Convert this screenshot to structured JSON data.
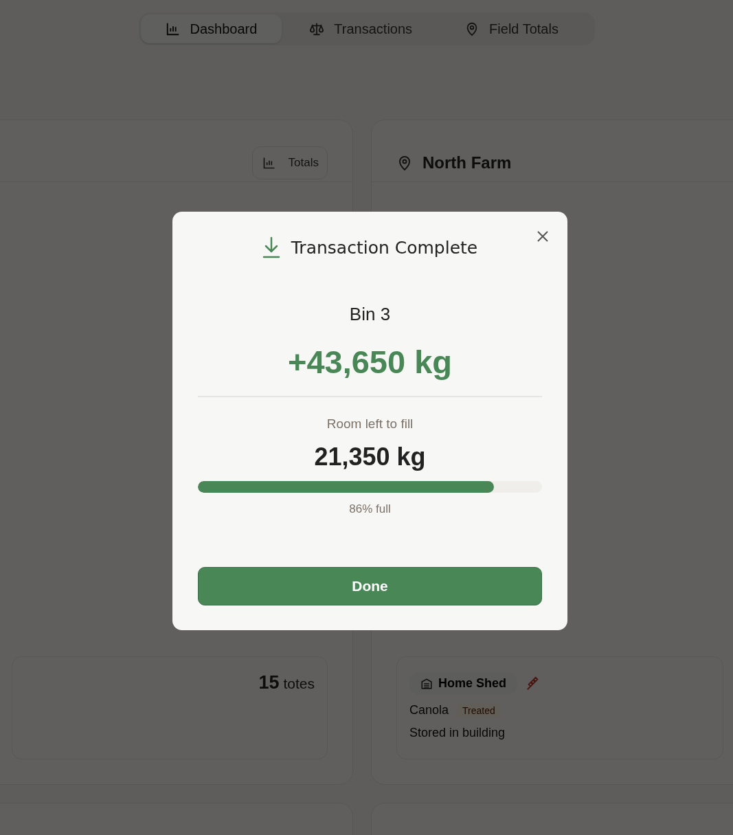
{
  "nav": {
    "tabs": [
      {
        "label": "Dashboard",
        "selected": true
      },
      {
        "label": "Transactions",
        "selected": false
      },
      {
        "label": "Field Totals",
        "selected": false
      }
    ]
  },
  "left_card": {
    "totals_button": "Totals",
    "totes": {
      "count": "15",
      "unit": "totes"
    }
  },
  "right_card": {
    "title": "North Farm",
    "storage": {
      "location": "Home Shed",
      "crop": "Canola",
      "badge": "Treated",
      "note": "Stored in building"
    }
  },
  "dialog": {
    "title": "Transaction Complete",
    "bin": "Bin 3",
    "amount": "+43,650 kg",
    "room_label": "Room left to fill",
    "room": "21,350 kg",
    "level": 0.86,
    "fill_reading": "86% full",
    "button": "Done"
  }
}
